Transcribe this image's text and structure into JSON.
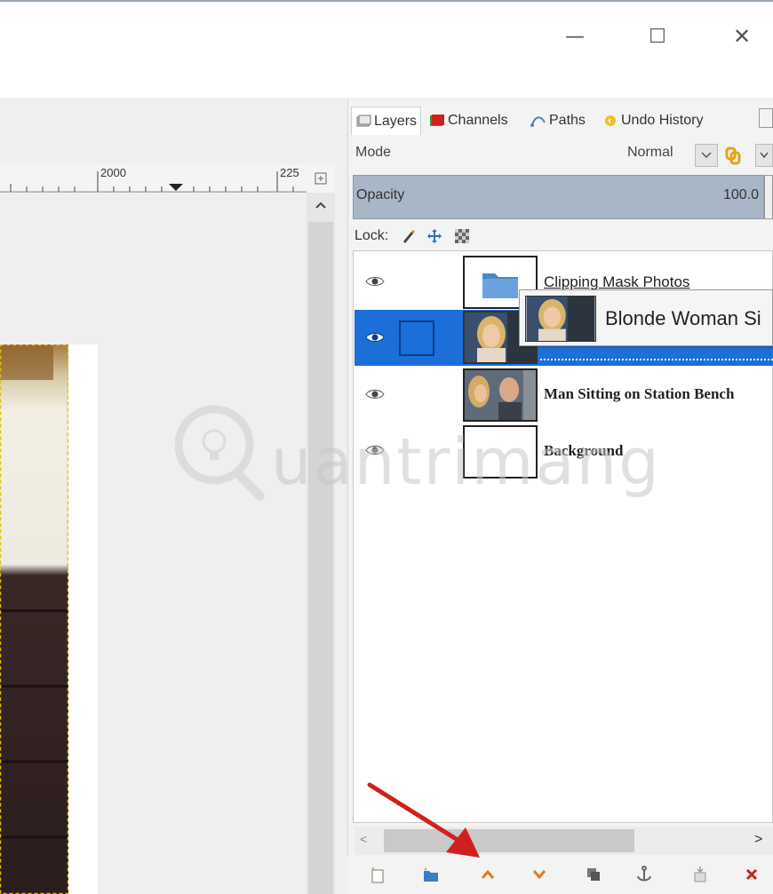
{
  "window": {
    "minimize": "—",
    "maximize": "☐",
    "close": "✕"
  },
  "ruler": {
    "label_2000": "2000",
    "label_225": "225"
  },
  "dock": {
    "tabs": [
      {
        "label": "Layers",
        "icon": "layers-icon",
        "active": true
      },
      {
        "label": "Channels",
        "icon": "channels-icon",
        "active": false
      },
      {
        "label": "Paths",
        "icon": "paths-icon",
        "active": false
      },
      {
        "label": "Undo History",
        "icon": "undo-history-icon",
        "active": false
      }
    ],
    "mode_label": "Mode",
    "mode_value": "Normal",
    "opacity_label": "Opacity",
    "opacity_value": "100.0",
    "lock_label": "Lock:"
  },
  "layers": [
    {
      "name": "Clipping Mask Photos",
      "type": "group",
      "visible": true,
      "selected": false
    },
    {
      "name": "",
      "type": "image",
      "visible": true,
      "selected": true
    },
    {
      "name": "Man Sitting on Station Bench",
      "type": "image",
      "visible": true,
      "selected": false
    },
    {
      "name": "Background",
      "type": "image",
      "visible": true,
      "selected": false
    }
  ],
  "drag_tooltip": {
    "label": "Blonde Woman Si"
  },
  "bottom_tools": [
    {
      "name": "new-layer-icon"
    },
    {
      "name": "new-layer-group-icon"
    },
    {
      "name": "raise-layer-icon"
    },
    {
      "name": "lower-layer-icon"
    },
    {
      "name": "duplicate-layer-icon"
    },
    {
      "name": "anchor-layer-icon"
    },
    {
      "name": "merge-layer-icon"
    },
    {
      "name": "delete-layer-icon"
    }
  ],
  "watermark": {
    "text": "uantrimang"
  },
  "colors": {
    "selection": "#1c6fd9",
    "opacity_bar": "#a9b6c7",
    "raise_lower": "#e07a1f",
    "delete": "#d0201a",
    "annotation_arrow": "#d01f1f"
  }
}
